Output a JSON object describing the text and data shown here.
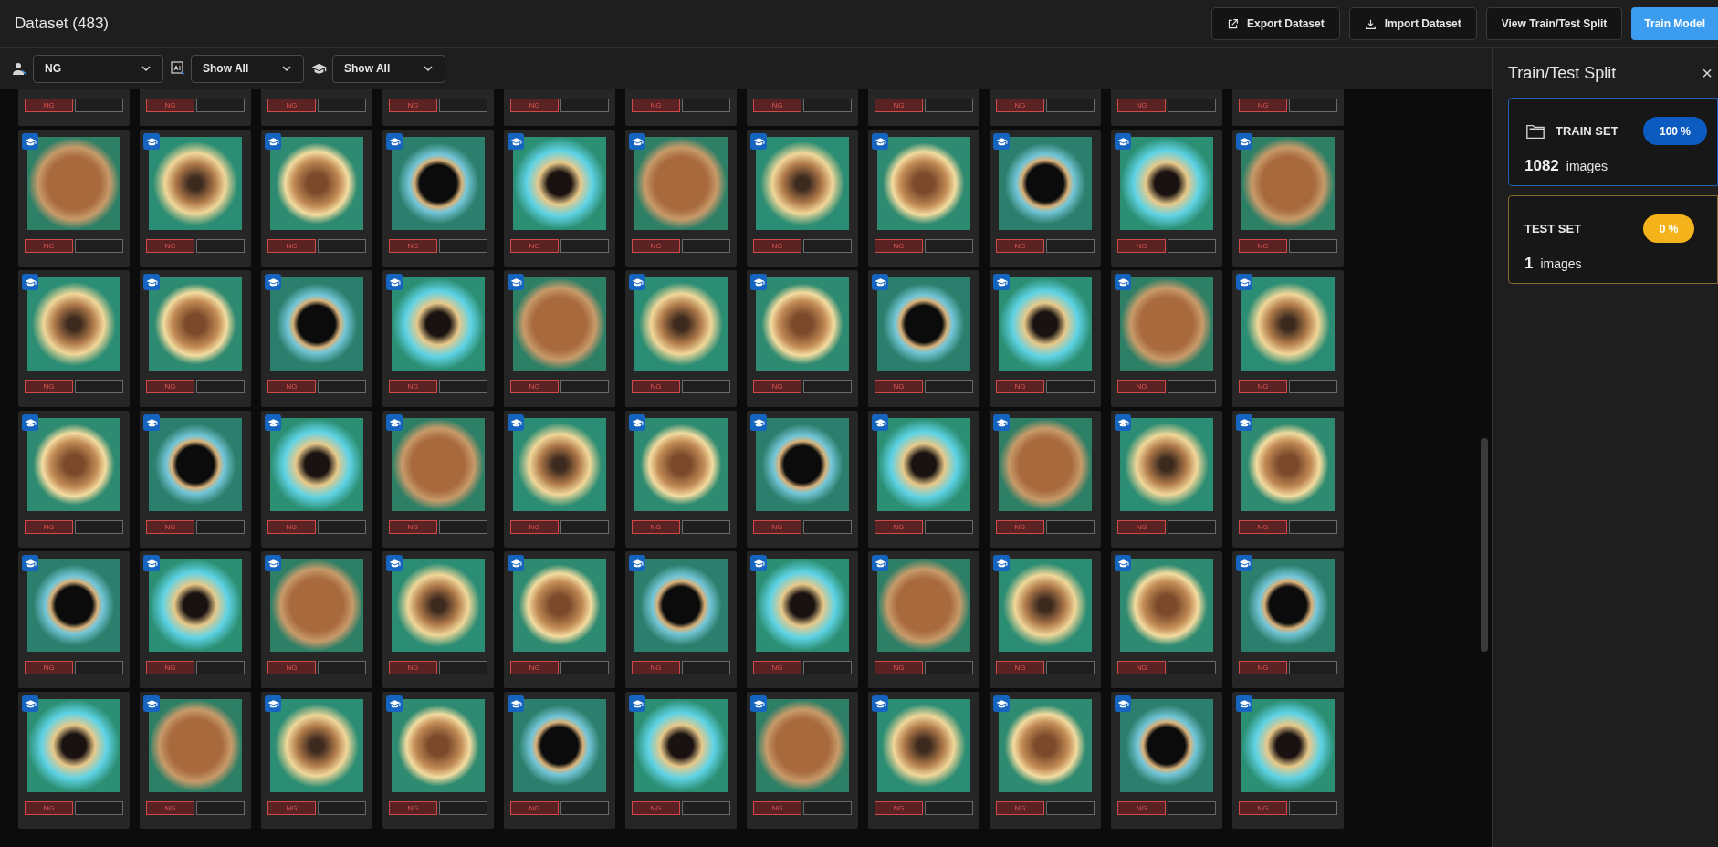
{
  "header": {
    "title": "Dataset (483)",
    "buttons": [
      {
        "label": "Export Dataset",
        "kind": "export"
      },
      {
        "label": "Import Dataset",
        "kind": "import"
      },
      {
        "label": "View Train/Test Split",
        "kind": "plain"
      },
      {
        "label": "Train Model",
        "kind": "primary"
      }
    ]
  },
  "filters": [
    {
      "kind": "user",
      "value": "NG"
    },
    {
      "kind": "image",
      "value": "Show All"
    },
    {
      "kind": "cap",
      "value": "Show All"
    }
  ],
  "tiles": [
    {
      "label": "NG"
    },
    {
      "label": "NG"
    },
    {
      "label": "NG"
    },
    {
      "label": "NG"
    },
    {
      "label": "NG"
    },
    {
      "label": "NG"
    },
    {
      "label": "NG"
    },
    {
      "label": "NG"
    },
    {
      "label": "NG"
    },
    {
      "label": "NG"
    },
    {
      "label": "NG"
    },
    {
      "label": "NG"
    },
    {
      "label": "NG"
    },
    {
      "label": "NG"
    },
    {
      "label": "NG"
    },
    {
      "label": "NG"
    },
    {
      "label": "NG"
    },
    {
      "label": "NG"
    },
    {
      "label": "NG"
    },
    {
      "label": "NG"
    },
    {
      "label": "NG"
    },
    {
      "label": "NG"
    },
    {
      "label": "NG"
    },
    {
      "label": "NG"
    },
    {
      "label": "NG"
    },
    {
      "label": "NG"
    },
    {
      "label": "NG"
    },
    {
      "label": "NG"
    },
    {
      "label": "NG"
    },
    {
      "label": "NG"
    },
    {
      "label": "NG"
    },
    {
      "label": "NG"
    },
    {
      "label": "NG"
    },
    {
      "label": "NG"
    },
    {
      "label": "NG"
    },
    {
      "label": "NG"
    },
    {
      "label": "NG"
    },
    {
      "label": "NG"
    },
    {
      "label": "NG"
    },
    {
      "label": "NG"
    },
    {
      "label": "NG"
    },
    {
      "label": "NG"
    },
    {
      "label": "NG"
    },
    {
      "label": "NG"
    },
    {
      "label": "NG"
    },
    {
      "label": "NG"
    },
    {
      "label": "NG"
    },
    {
      "label": "NG"
    },
    {
      "label": "NG"
    },
    {
      "label": "NG"
    },
    {
      "label": "NG"
    },
    {
      "label": "NG"
    },
    {
      "label": "NG"
    },
    {
      "label": "NG"
    },
    {
      "label": "NG"
    },
    {
      "label": "NG"
    },
    {
      "label": "NG"
    },
    {
      "label": "NG"
    },
    {
      "label": "NG"
    },
    {
      "label": "NG"
    },
    {
      "label": "NG"
    },
    {
      "label": "NG"
    },
    {
      "label": "NG"
    },
    {
      "label": "NG"
    },
    {
      "label": "NG"
    },
    {
      "label": "NG"
    }
  ],
  "split_panel": {
    "title": "Train/Test Split",
    "close": "×",
    "sets": [
      {
        "kind": "train",
        "name": "TRAIN SET",
        "percent": "100 %",
        "count": "1082",
        "unit": "images"
      },
      {
        "kind": "test",
        "name": "TEST SET",
        "percent": "0 %",
        "count": "1",
        "unit": "images"
      }
    ]
  }
}
